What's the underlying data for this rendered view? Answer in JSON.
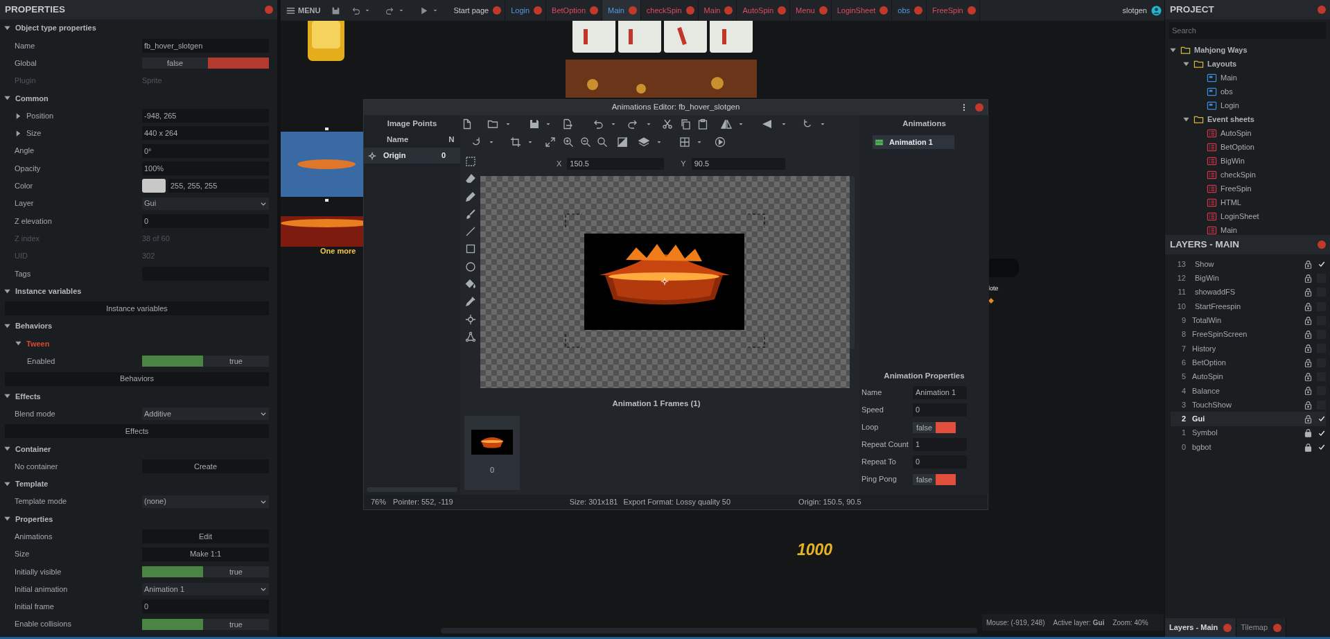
{
  "properties_panel": {
    "title": "PROPERTIES",
    "sections": [
      {
        "title": "Object type properties",
        "expanded": true,
        "rows": [
          {
            "kind": "text",
            "label": "Name",
            "value": "fb_hover_slotgen"
          },
          {
            "kind": "toggle",
            "label": "Global",
            "value": "false",
            "on": false
          },
          {
            "kind": "readonly",
            "label": "Plugin",
            "value": "Sprite"
          }
        ]
      },
      {
        "title": "Common",
        "expanded": true,
        "rows": [
          {
            "kind": "text",
            "label": "Position",
            "value": "-948, 265",
            "expanded": false
          },
          {
            "kind": "text",
            "label": "Size",
            "value": "440 x 264",
            "expanded": false
          },
          {
            "kind": "text",
            "label": "Angle",
            "value": "0°"
          },
          {
            "kind": "text",
            "label": "Opacity",
            "value": "100%"
          },
          {
            "kind": "color",
            "label": "Color",
            "value": "255, 255, 255"
          },
          {
            "kind": "select",
            "label": "Layer",
            "value": "Gui"
          },
          {
            "kind": "text",
            "label": "Z elevation",
            "value": "0"
          },
          {
            "kind": "readonly",
            "label": "Z index",
            "value": "38 of 60"
          },
          {
            "kind": "readonly",
            "label": "UID",
            "value": "302"
          },
          {
            "kind": "text",
            "label": "Tags"
          }
        ]
      },
      {
        "title": "Instance variables",
        "expanded": true,
        "rows": [
          {
            "kind": "wide",
            "value": "Instance variables"
          }
        ]
      },
      {
        "title": "Behaviors",
        "expanded": true,
        "rows": [
          {
            "kind": "group",
            "label": "Tween",
            "expanded": true,
            "children": [
              {
                "kind": "toggle",
                "label": "Enabled",
                "value": "true",
                "on": true
              }
            ]
          },
          {
            "kind": "wide",
            "value": "Behaviors"
          }
        ]
      },
      {
        "title": "Effects",
        "expanded": true,
        "rows": [
          {
            "kind": "select",
            "label": "Blend mode",
            "value": "Additive"
          },
          {
            "kind": "wide",
            "value": "Effects"
          }
        ]
      },
      {
        "title": "Container",
        "expanded": true,
        "rows": [
          {
            "kind": "button",
            "label": "No container",
            "value": "Create"
          }
        ]
      },
      {
        "title": "Template",
        "expanded": true,
        "rows": [
          {
            "kind": "select",
            "label": "Template mode",
            "value": "(none)"
          }
        ]
      },
      {
        "title": "Properties",
        "expanded": true,
        "rows": [
          {
            "kind": "button",
            "label": "Animations",
            "value": "Edit"
          },
          {
            "kind": "button",
            "label": "Size",
            "value": "Make 1:1"
          },
          {
            "kind": "toggle",
            "label": "Initially visible",
            "value": "true",
            "on": true
          },
          {
            "kind": "select",
            "label": "Initial animation",
            "value": "Animation 1"
          },
          {
            "kind": "text",
            "label": "Initial frame",
            "value": "0"
          },
          {
            "kind": "toggle",
            "label": "Enable collisions",
            "value": "true",
            "on": true
          }
        ]
      }
    ]
  },
  "top_bar": {
    "menu": "MENU",
    "tabs": [
      {
        "label": "Start page",
        "kind": "start",
        "selected": false
      },
      {
        "label": "Login",
        "kind": "layout",
        "selected": false
      },
      {
        "label": "BetOption",
        "kind": "event",
        "selected": false
      },
      {
        "label": "Main",
        "kind": "layout",
        "selected": true
      },
      {
        "label": "checkSpin",
        "kind": "event",
        "selected": false
      },
      {
        "label": "Main",
        "kind": "event",
        "selected": false
      },
      {
        "label": "AutoSpin",
        "kind": "event",
        "selected": false
      },
      {
        "label": "Menu",
        "kind": "event",
        "selected": false
      },
      {
        "label": "LoginSheet",
        "kind": "event",
        "selected": false
      },
      {
        "label": "obs",
        "kind": "layout",
        "selected": false
      },
      {
        "label": "FreeSpin",
        "kind": "event",
        "selected": false
      }
    ],
    "user": "slotgen"
  },
  "layout_view": {
    "sprite_caption": "One more",
    "note_text": "lote",
    "score_text": "1000"
  },
  "layout_status": {
    "mouse": "Mouse: (-919, 248)",
    "active_layer": "Active layer: **Gui**",
    "zoom": "Zoom: 40%"
  },
  "animations_editor": {
    "title": "Animations Editor: fb_hover_slotgen",
    "image_points": {
      "title": "Image Points",
      "columns": [
        "Name",
        "N"
      ],
      "rows": [
        {
          "name": "Origin",
          "column_2": "0",
          "selected": true
        }
      ]
    },
    "x_label": "X",
    "x_value": "150.5",
    "y_label": "Y",
    "y_value": "90.5",
    "frames_title": "Animation 1 Frames (1)",
    "frames": [
      {
        "label": "0",
        "selected": true
      }
    ],
    "animations": {
      "title": "Animations",
      "items": [
        {
          "name": "Animation 1",
          "selected": true
        }
      ]
    },
    "animation_properties": {
      "title": "Animation Properties",
      "rows": [
        {
          "kind": "text",
          "label": "Name",
          "value": "Animation 1"
        },
        {
          "kind": "text",
          "label": "Speed",
          "value": "0"
        },
        {
          "kind": "toggle",
          "label": "Loop",
          "value": "false",
          "on": false
        },
        {
          "kind": "text",
          "label": "Repeat Count",
          "value": "1"
        },
        {
          "kind": "text",
          "label": "Repeat To",
          "value": "0"
        },
        {
          "kind": "toggle",
          "label": "Ping Pong",
          "value": "false",
          "on": false
        }
      ]
    },
    "status": [
      "76%",
      "Pointer: 552, -119",
      "Size: 301x181",
      "Export Format: Lossy quality 50",
      "Origin: 150.5, 90.5"
    ]
  },
  "project": {
    "title": "PROJECT",
    "search_placeholder": "Search",
    "tree": [
      {
        "label": "Mahjong Ways",
        "kind": "folder",
        "expanded": true,
        "children": [
          {
            "label": "Layouts",
            "kind": "folder",
            "expanded": true,
            "children": [
              {
                "label": "Main",
                "kind": "layout"
              },
              {
                "label": "obs",
                "kind": "layout"
              },
              {
                "label": "Login",
                "kind": "layout"
              }
            ]
          },
          {
            "label": "Event sheets",
            "kind": "folder",
            "expanded": true,
            "children": [
              {
                "label": "AutoSpin",
                "kind": "event"
              },
              {
                "label": "BetOption",
                "kind": "event"
              },
              {
                "label": "BigWin",
                "kind": "event"
              },
              {
                "label": "checkSpin",
                "kind": "event"
              },
              {
                "label": "FreeSpin",
                "kind": "event"
              },
              {
                "label": "HTML",
                "kind": "event"
              },
              {
                "label": "LoginSheet",
                "kind": "event"
              },
              {
                "label": "Main",
                "kind": "event"
              }
            ]
          }
        ]
      }
    ]
  },
  "layers": {
    "title": "LAYERS - MAIN",
    "rows": [
      {
        "number": "13",
        "name": "Show",
        "kind": "sublayer",
        "locked": false,
        "visible": true,
        "selected": false
      },
      {
        "number": "12",
        "name": "BigWin",
        "kind": "sublayer",
        "locked": false,
        "visible": false,
        "selected": false
      },
      {
        "number": "11",
        "name": "showaddFS",
        "kind": "sublayer",
        "locked": false,
        "visible": false,
        "selected": false
      },
      {
        "number": "10",
        "name": "StartFreespin",
        "kind": "sublayer",
        "locked": false,
        "visible": false,
        "selected": false
      },
      {
        "number": "9",
        "name": "TotalWin",
        "kind": "layer",
        "locked": false,
        "visible": false,
        "selected": false
      },
      {
        "number": "8",
        "name": "FreeSpinScreen",
        "kind": "layer",
        "locked": false,
        "visible": false,
        "selected": false
      },
      {
        "number": "7",
        "name": "History",
        "kind": "layer",
        "locked": false,
        "visible": false,
        "selected": false
      },
      {
        "number": "6",
        "name": "BetOption",
        "kind": "layer",
        "locked": false,
        "visible": false,
        "selected": false
      },
      {
        "number": "5",
        "name": "AutoSpin",
        "kind": "layer",
        "locked": false,
        "visible": false,
        "selected": false
      },
      {
        "number": "4",
        "name": "Balance",
        "kind": "layer",
        "locked": false,
        "visible": false,
        "selected": false
      },
      {
        "number": "3",
        "name": "TouchShow",
        "kind": "layer",
        "locked": false,
        "visible": false,
        "selected": false
      },
      {
        "number": "2",
        "name": "Gui",
        "kind": "layer",
        "locked": false,
        "visible": true,
        "selected": true
      },
      {
        "number": "1",
        "name": "Symbol",
        "kind": "layer",
        "locked": true,
        "visible": true,
        "selected": false
      },
      {
        "number": "0",
        "name": "bgbot",
        "kind": "layer",
        "locked": true,
        "visible": true,
        "selected": false
      }
    ]
  },
  "bottom_tabs": [
    {
      "label": "Layers - Main",
      "selected": true
    },
    {
      "label": "Tilemap",
      "selected": false
    }
  ]
}
